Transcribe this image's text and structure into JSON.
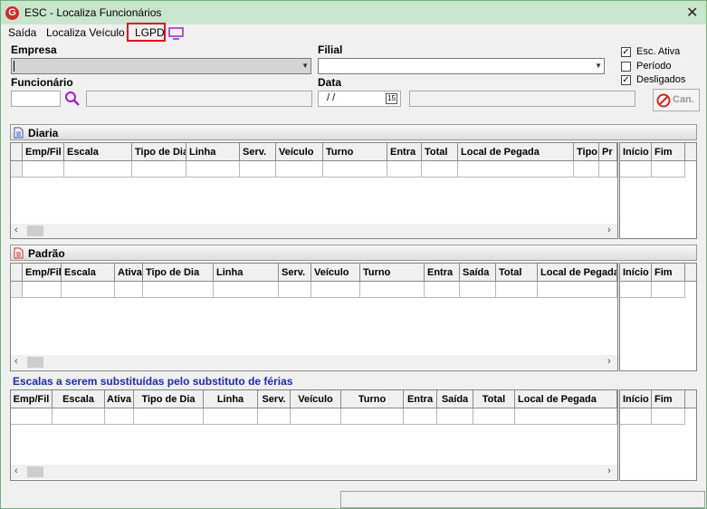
{
  "window": {
    "title": "ESC - Localiza Funcionários",
    "logo_letter": "G",
    "close_glyph": "✕"
  },
  "menu": {
    "items": [
      "Saída",
      "Localiza Veículo",
      "LGPD"
    ]
  },
  "form": {
    "empresa_label": "Empresa",
    "filial_label": "Filial",
    "funcionario_label": "Funcionário",
    "data_label": "Data",
    "date_value": " / /",
    "calendar_glyph": "15",
    "checkboxes": [
      {
        "label": "Esc. Ativa",
        "checked": true
      },
      {
        "label": "Período",
        "checked": false
      },
      {
        "label": "Desligados",
        "checked": true
      }
    ],
    "cancel_label": "Can."
  },
  "diaria": {
    "title": "Diaria",
    "columns": [
      "Emp/Fil",
      "Escala",
      "Tipo de Dia",
      "Linha",
      "Serv.",
      "Veículo",
      "Turno",
      "Entra",
      "Total",
      "Local de Pegada",
      "Tipo",
      "Pr"
    ],
    "side_columns": [
      "Início",
      "Fim"
    ]
  },
  "padrao": {
    "title": "Padrão",
    "columns": [
      "Emp/Fil",
      "Escala",
      "Ativa",
      "Tipo de Dia",
      "Linha",
      "Serv.",
      "Veículo",
      "Turno",
      "Entra",
      "Saída",
      "Total",
      "Local de Pegada"
    ],
    "side_columns": [
      "Início",
      "Fim"
    ]
  },
  "substituidas": {
    "title": "Escalas a serem substituídas pelo substituto de férias",
    "columns": [
      "Emp/Fil",
      "Escala",
      "Ativa",
      "Tipo de Dia",
      "Linha",
      "Serv.",
      "Veículo",
      "Turno",
      "Entra",
      "Saída",
      "Total",
      "Local de Pegada"
    ],
    "side_columns": [
      "Início",
      "Fim"
    ]
  },
  "colors": {
    "title_bar": "#c8e6cc",
    "lgpd_border": "#e0101a",
    "section_title": "#1f2bb0",
    "monitor_icon": "#9b30d9"
  }
}
